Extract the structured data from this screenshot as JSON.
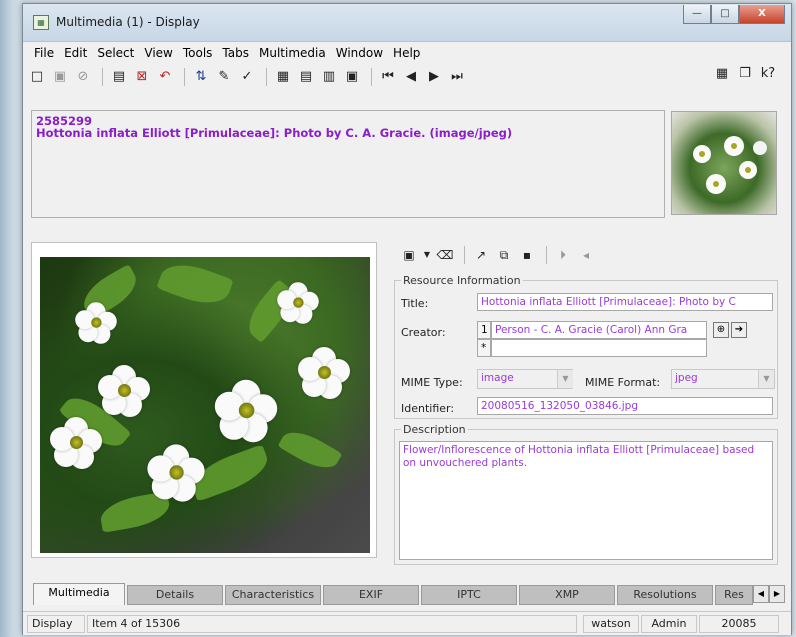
{
  "window": {
    "title": "Multimedia (1) - Display",
    "minimize": "—",
    "maximize": "□",
    "close": "X"
  },
  "menu": [
    "File",
    "Edit",
    "Select",
    "View",
    "Tools",
    "Tabs",
    "Multimedia",
    "Window",
    "Help"
  ],
  "toolbar": {
    "help_label": "k?"
  },
  "record": {
    "id": "2585299",
    "title": "Hottonia inflata Elliott [Primulaceae]: Photo by C. A. Gracie. (image/jpeg)"
  },
  "resource_info": {
    "group_label": "Resource Information",
    "title_label": "Title:",
    "title_value": "Hottonia inflata Elliott [Primulaceae]: Photo by C",
    "creator_label": "Creator:",
    "creator_index": "1",
    "creator_value": "Person - C. A. Gracie (Carol) Ann Gra",
    "add_label": "*",
    "mime_type_label": "MIME Type:",
    "mime_type_value": "image",
    "mime_format_label": "MIME Format:",
    "mime_format_value": "jpeg",
    "identifier_label": "Identifier:",
    "identifier_value": "20080516_132050_03846.jpg"
  },
  "description": {
    "group_label": "Description",
    "text": "Flower/Inflorescence of Hottonia inflata Elliott [Primulaceae] based on unvouchered plants."
  },
  "tabs": [
    "Multimedia",
    "Details",
    "Characteristics",
    "EXIF",
    "IPTC",
    "XMP",
    "Resolutions",
    "Res"
  ],
  "active_tab": "Multimedia",
  "status": {
    "mode": "Display",
    "position": "Item 4 of 15306",
    "user": "watson",
    "role": "Admin",
    "count": "20085"
  },
  "colors": {
    "accent_text": "#9a3ad8",
    "header_text": "#8a1ec8"
  }
}
